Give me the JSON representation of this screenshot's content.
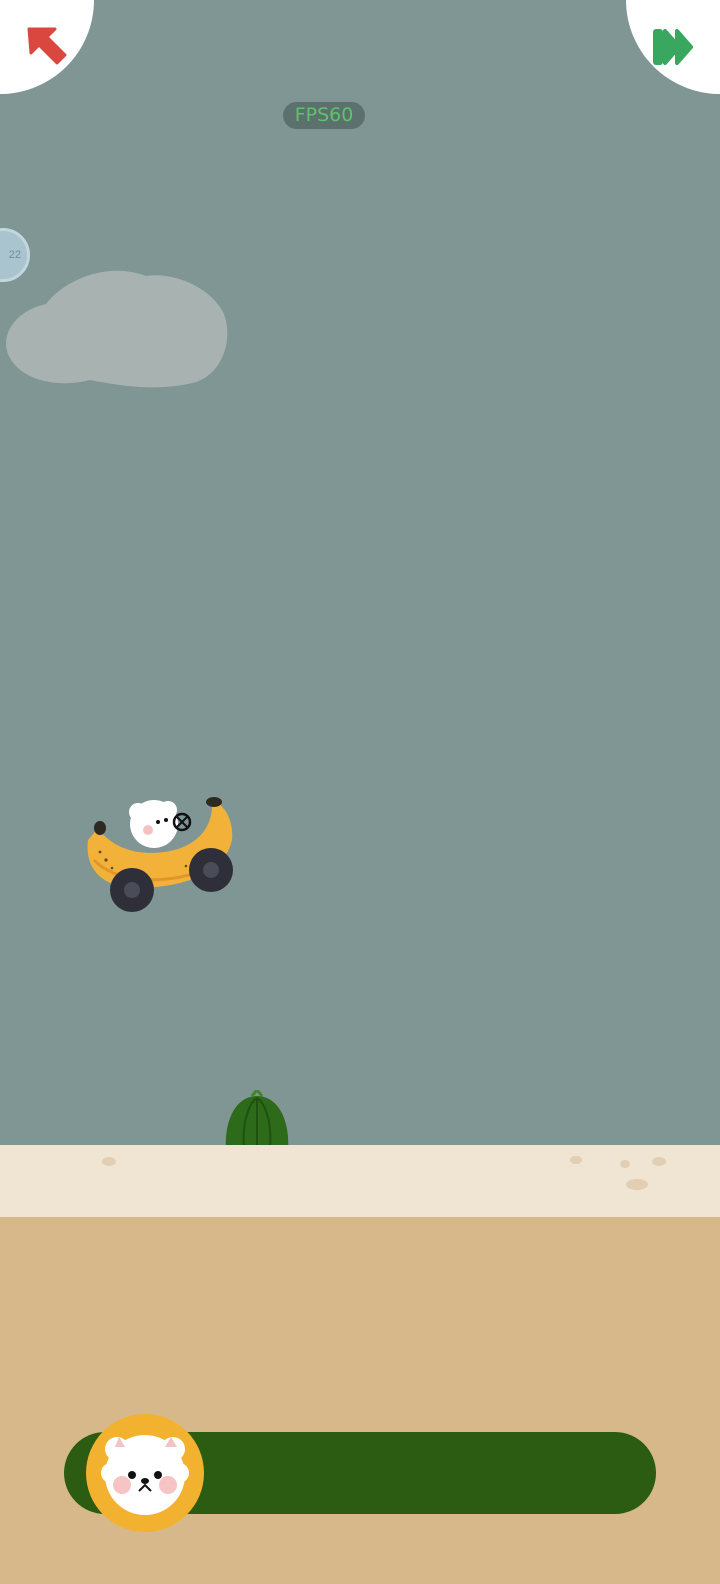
{
  "hud": {
    "fps_label": "FPS60",
    "side_badge": "22",
    "back_icon": "arrow-up-left-icon",
    "fast_forward_icon": "fast-forward-icon"
  },
  "colors": {
    "sky": "#7f9694",
    "sand_light": "#f0e5d3",
    "sand_dark": "#d7b88a",
    "progress_track": "#2b5c12",
    "avatar_ring": "#f2b230",
    "back_arrow": "#d9473f",
    "fast_forward": "#3aa760"
  },
  "level_progress": {
    "fraction": 0.0
  }
}
